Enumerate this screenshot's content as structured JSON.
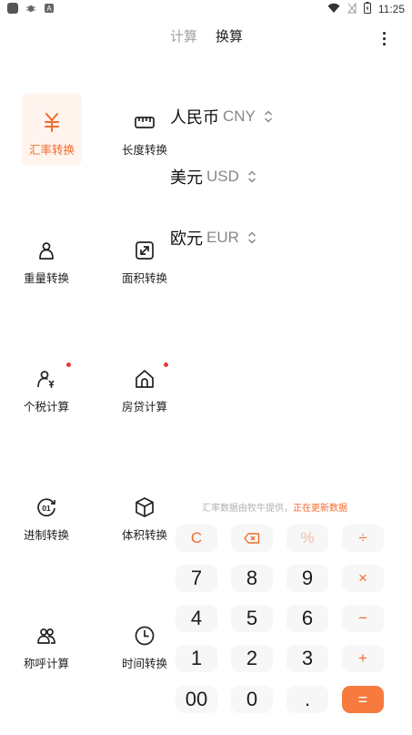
{
  "status_bar": {
    "time": "11:25"
  },
  "tabs": {
    "calc": "计算",
    "convert": "换算"
  },
  "categories": [
    {
      "label": "汇率转换",
      "icon": "yuan-icon",
      "active": true
    },
    {
      "label": "长度转换",
      "icon": "ruler-icon"
    },
    {
      "label": "重量转换",
      "icon": "weight-icon"
    },
    {
      "label": "面积转换",
      "icon": "area-icon"
    },
    {
      "label": "个税计算",
      "icon": "person-yen-icon",
      "badge": true
    },
    {
      "label": "房贷计算",
      "icon": "house-icon",
      "badge": true
    },
    {
      "label": "进制转换",
      "icon": "binary-icon"
    },
    {
      "label": "体积转换",
      "icon": "cube-icon"
    },
    {
      "label": "称呼计算",
      "icon": "people-icon"
    },
    {
      "label": "时间转换",
      "icon": "clock-icon"
    }
  ],
  "currencies": [
    {
      "name": "人民币",
      "code": "CNY"
    },
    {
      "name": "美元",
      "code": "USD"
    },
    {
      "name": "欧元",
      "code": "EUR"
    }
  ],
  "info": {
    "source": "汇率数据由牧牛提供，",
    "status": "正在更新数据"
  },
  "keypad": {
    "clear": "C",
    "percent": "%",
    "divide": "÷",
    "multiply": "×",
    "minus": "−",
    "plus": "+",
    "equals": "=",
    "digits": [
      "7",
      "8",
      "9",
      "4",
      "5",
      "6",
      "1",
      "2",
      "3",
      "00",
      "0",
      "."
    ]
  },
  "colors": {
    "accent": "#f26b2c",
    "equals_bg": "#f77a3e",
    "active_bg": "#fff4ee",
    "badge": "#e53935"
  }
}
